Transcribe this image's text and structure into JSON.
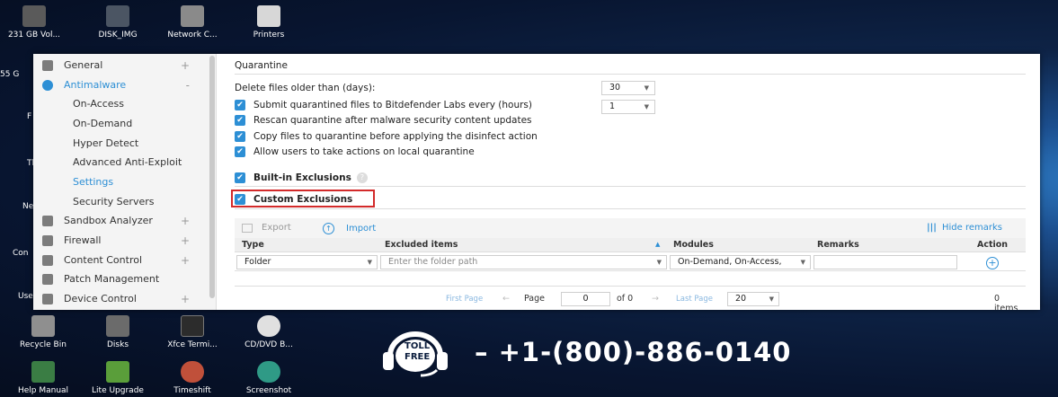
{
  "desktop": {
    "top_icons": [
      "231 GB Vol...",
      "DISK_IMG",
      "Network C...",
      "Printers"
    ],
    "left_partial": [
      "55 G",
      "F",
      "Tl",
      "Ne",
      "Con",
      "Use"
    ],
    "bottom_icons": [
      "Recycle Bin",
      "Disks",
      "Xfce Termi...",
      "CD/DVD B..."
    ],
    "bottom_icons2": [
      "Help Manual",
      "Lite Upgrade",
      "Timeshift",
      "Screenshot"
    ]
  },
  "sidebar": {
    "items": [
      {
        "label": "General",
        "expander": "+"
      },
      {
        "label": "Antimalware",
        "expander": "-"
      },
      {
        "label": "On-Access"
      },
      {
        "label": "On-Demand"
      },
      {
        "label": "Hyper Detect"
      },
      {
        "label": "Advanced Anti-Exploit"
      },
      {
        "label": "Settings"
      },
      {
        "label": "Security Servers"
      },
      {
        "label": "Sandbox Analyzer",
        "expander": "+"
      },
      {
        "label": "Firewall",
        "expander": "+"
      },
      {
        "label": "Content Control",
        "expander": "+"
      },
      {
        "label": "Patch Management"
      },
      {
        "label": "Device Control",
        "expander": "+"
      }
    ]
  },
  "quarantine": {
    "title": "Quarantine",
    "delete_label": "Delete files older than (days):",
    "delete_value": "30",
    "submit_label": "Submit quarantined files to Bitdefender Labs every (hours)",
    "submit_value": "1",
    "rescan_label": "Rescan quarantine after malware security content updates",
    "copy_label": "Copy files to quarantine before applying the disinfect action",
    "allow_label": "Allow users to take actions on local quarantine"
  },
  "exclusions": {
    "builtin_label": "Built-in Exclusions",
    "custom_label": "Custom Exclusions",
    "export_label": "Export",
    "import_label": "Import",
    "hide_remarks_label": "Hide remarks",
    "columns": [
      "Type",
      "Excluded items",
      "Modules",
      "Remarks",
      "Action"
    ],
    "row": {
      "type": "Folder",
      "path_placeholder": "Enter the folder path",
      "modules": "On-Demand, On-Access,"
    }
  },
  "pager": {
    "first": "First Page",
    "page_label": "Page",
    "page_value": "0",
    "of_label": "of 0",
    "last": "Last Page",
    "per_page": "20",
    "items": "0 items"
  },
  "overlay": {
    "toll_free_line1": "TOLL",
    "toll_free_line2": "FREE",
    "phone": "– +1-(800)-886-0140"
  },
  "colors": {
    "accent": "#2d8fd5",
    "highlight": "#d32a2a"
  }
}
